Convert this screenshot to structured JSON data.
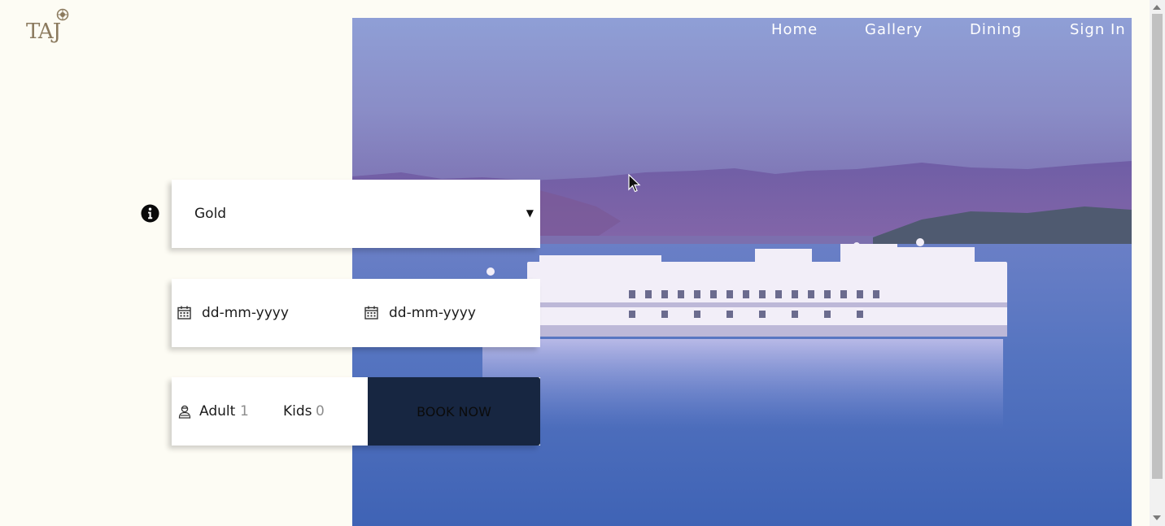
{
  "brand": {
    "logo_text": "TAJ"
  },
  "nav": {
    "items": [
      {
        "label": "Home"
      },
      {
        "label": "Gallery"
      },
      {
        "label": "Dining"
      },
      {
        "label": "Sign In"
      }
    ]
  },
  "booking": {
    "membership": {
      "selected": "Gold"
    },
    "checkin": {
      "placeholder": "dd-mm-yyyy"
    },
    "checkout": {
      "placeholder": "dd-mm-yyyy"
    },
    "guests": {
      "adult_label": "Adult",
      "adult_value": "1",
      "kids_label": "Kids",
      "kids_value": "0"
    },
    "book_label": "BOOK NOW"
  },
  "colors": {
    "page_bg": "#fdfcf4",
    "book_button": "#172641",
    "logo": "#8b7a5e"
  },
  "icons": [
    "info-icon",
    "calendar-icon",
    "guest-icon",
    "chevron-down-icon",
    "logo-emblem"
  ]
}
